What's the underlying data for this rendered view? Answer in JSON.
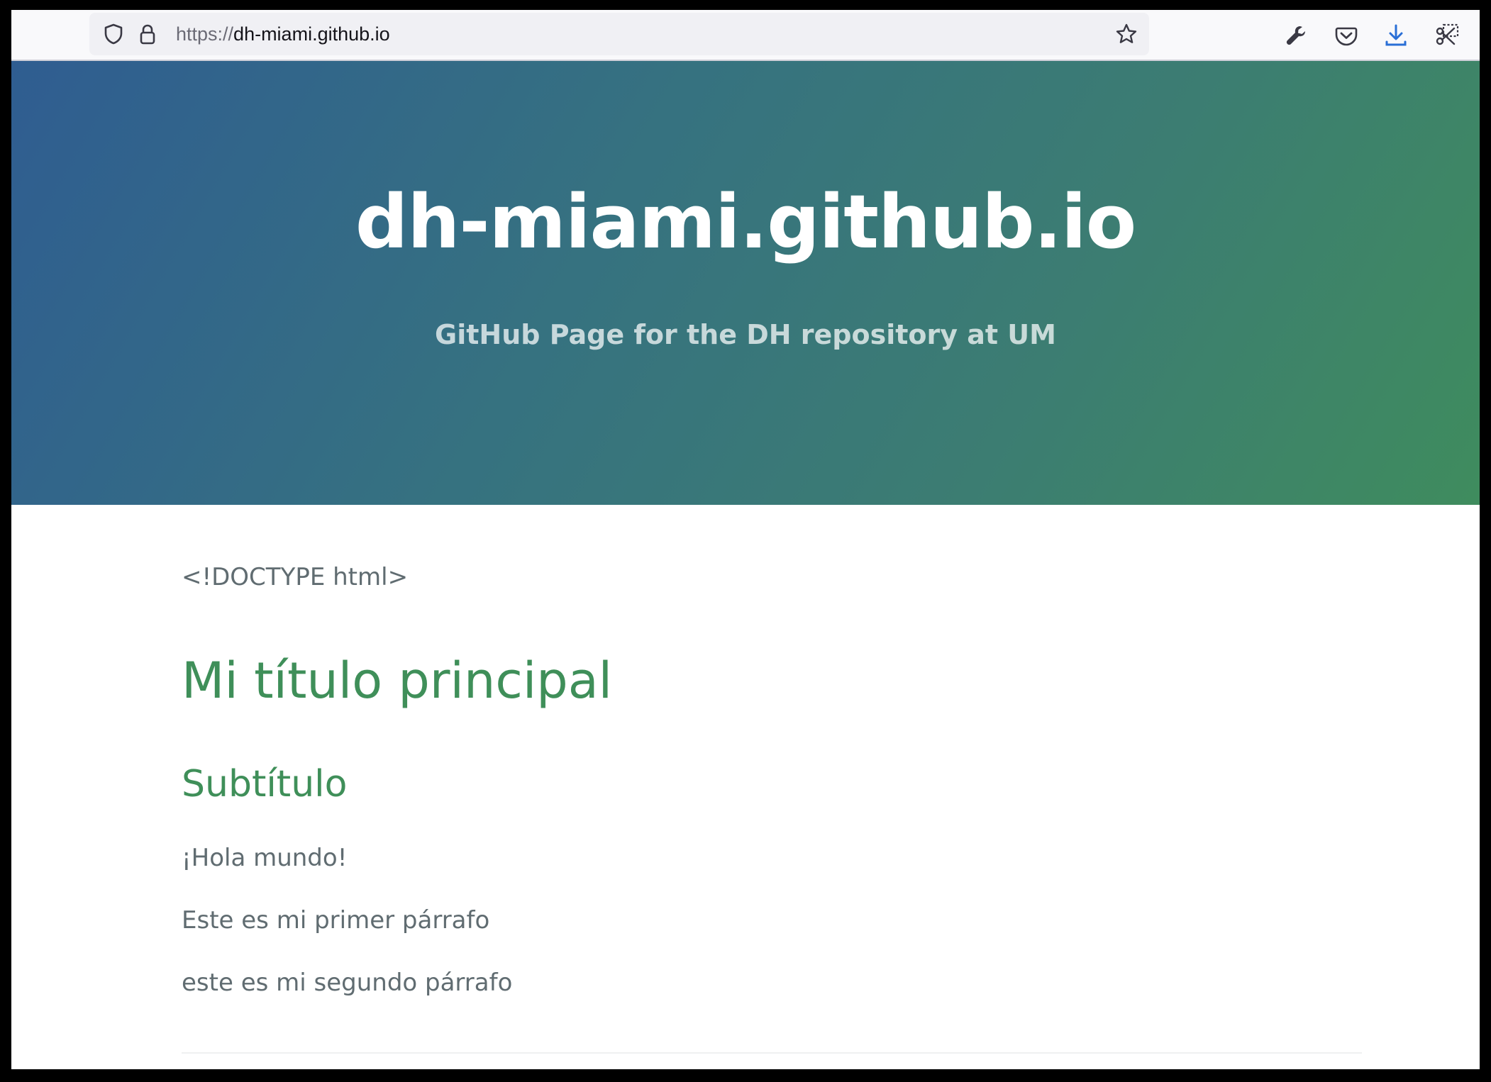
{
  "browser": {
    "url_scheme": "https://",
    "url_host": "dh-miami.github.io",
    "icons": {
      "tracking": "shield-icon",
      "security": "lock-icon",
      "bookmark": "star-icon",
      "devtools": "wrench-icon",
      "pocket": "pocket-icon",
      "downloads": "download-icon",
      "screenshot": "screenshot-icon"
    },
    "accent_color": "#2a6fd6"
  },
  "header": {
    "project_name": "dh-miami.github.io",
    "tagline": "GitHub Page for the DH repository at UM",
    "gradient_start": "#2f5d91",
    "gradient_end": "#3f8c5e"
  },
  "content": {
    "doctype_text": "<!DOCTYPE html>",
    "heading_1": "Mi título principal",
    "heading_2": "Subtítulo",
    "paragraphs": [
      "¡Hola mundo!",
      "Este es mi primer párrafo",
      "este es mi segundo párrafo"
    ],
    "heading_color": "#3f8f59",
    "text_color": "#606c71"
  }
}
